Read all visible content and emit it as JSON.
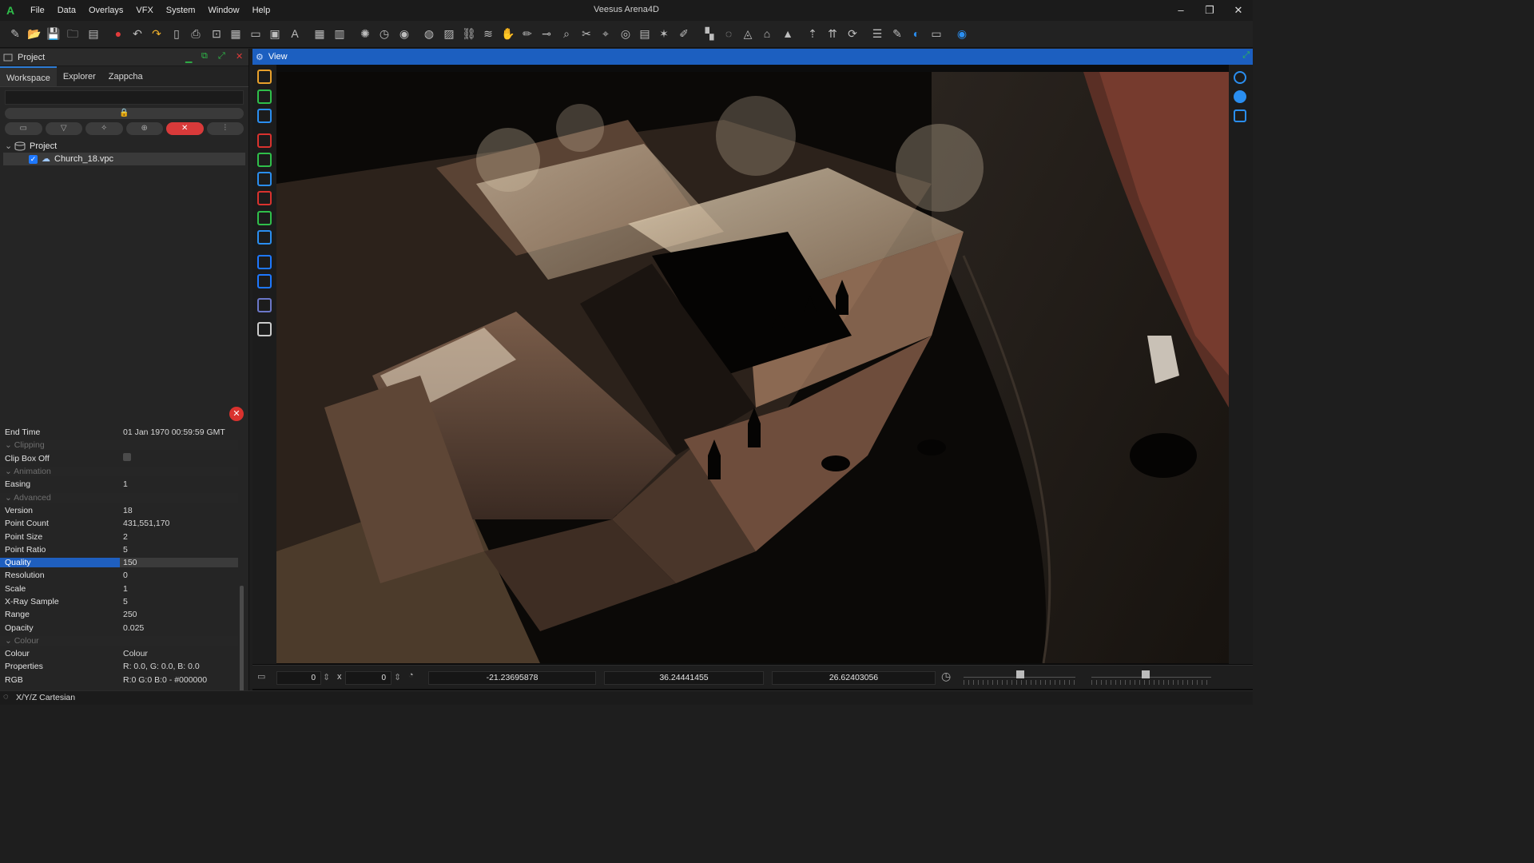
{
  "window": {
    "title": "Veesus Arena4D",
    "minimize": "–",
    "restore": "❐",
    "close": "✕"
  },
  "menu": [
    "File",
    "Data",
    "Overlays",
    "VFX",
    "System",
    "Window",
    "Help"
  ],
  "toolbar_icons": [
    "new-icon",
    "open-icon",
    "save-icon",
    "folder-icon",
    "csv-icon",
    "stop-icon",
    "undo-icon",
    "redo-icon",
    "page-icon",
    "print-icon",
    "camera-icon",
    "pdf-icon",
    "video-icon",
    "monitor-icon",
    "text-icon",
    "pdf-export-icon",
    "ppt-export-icon",
    "atom-icon",
    "clock-icon",
    "target-icon",
    "sphere-icon",
    "image-icon",
    "link-icon",
    "layers-icon",
    "hand-icon",
    "brush-icon",
    "pipe-icon",
    "zoom-icon",
    "scissors-icon",
    "pin-icon",
    "globe-icon",
    "cube-icon",
    "star-icon",
    "pencil-icon",
    "blocks-icon",
    "compass-icon",
    "navigate-icon",
    "house-icon",
    "triangle-icon",
    "up-arrow-icon",
    "up-double-icon",
    "refresh-icon",
    "list-icon",
    "ruler-icon",
    "mouse-icon",
    "window-icon",
    "eye-icon"
  ],
  "panel": {
    "title": "Project",
    "tabs": [
      "Workspace",
      "Explorer",
      "Zappcha"
    ],
    "tree": [
      {
        "label": "Project",
        "type": "root"
      },
      {
        "label": "Church_18.vpc",
        "type": "cloud",
        "checked": true
      }
    ]
  },
  "properties": [
    {
      "k": "End Time",
      "v": "01 Jan 1970 00:59:59 GMT"
    },
    {
      "k": "Clipping",
      "group": true
    },
    {
      "k": "Clip Box Off",
      "v": "",
      "checkbox": true
    },
    {
      "k": "Animation",
      "group": true
    },
    {
      "k": "Easing",
      "v": "1"
    },
    {
      "k": "Advanced",
      "group": true
    },
    {
      "k": "Version",
      "v": "18"
    },
    {
      "k": "Point Count",
      "v": "431,551,170"
    },
    {
      "k": "Point Size",
      "v": "2"
    },
    {
      "k": "Point Ratio",
      "v": "5"
    },
    {
      "k": "Quality",
      "v": "150",
      "selected": true
    },
    {
      "k": "Resolution",
      "v": "0"
    },
    {
      "k": "Scale",
      "v": "1"
    },
    {
      "k": "X-Ray Sample",
      "v": "5"
    },
    {
      "k": "Range",
      "v": "250"
    },
    {
      "k": "Opacity",
      "v": "0.025"
    },
    {
      "k": "Colour",
      "group": true
    },
    {
      "k": "Colour",
      "v": "Colour"
    },
    {
      "k": "Properties",
      "v": "R: 0.0, G: 0.0, B: 0.0"
    },
    {
      "k": "RGB",
      "v": "R:0 G:0 B:0 - #000000"
    }
  ],
  "view": {
    "title": "View"
  },
  "status": {
    "width": "0",
    "times": "x",
    "height": "0",
    "x": "-21.23695878",
    "y": "36.24441455",
    "z": "26.62403056"
  },
  "bottom": {
    "coordinate_system": "X/Y/Z Cartesian"
  },
  "colors": {
    "accent": "#1c5fc0",
    "selection": "#1f5fbf",
    "danger": "#d9322e"
  }
}
